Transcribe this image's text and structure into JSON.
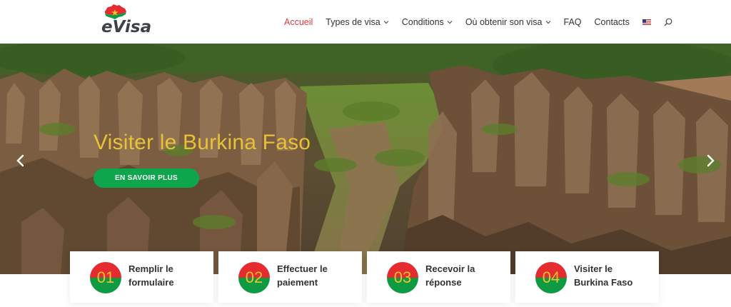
{
  "brand": {
    "logo_text": "eVisa"
  },
  "nav": {
    "items": [
      {
        "label": "Accueil",
        "active": true,
        "dropdown": false
      },
      {
        "label": "Types de visa",
        "active": false,
        "dropdown": true
      },
      {
        "label": "Conditions",
        "active": false,
        "dropdown": true
      },
      {
        "label": "Où obtenir son visa",
        "active": false,
        "dropdown": true
      },
      {
        "label": "FAQ",
        "active": false,
        "dropdown": false
      },
      {
        "label": "Contacts",
        "active": false,
        "dropdown": false
      }
    ],
    "language_icon": "us-flag-icon",
    "search_icon": "search-icon"
  },
  "hero": {
    "title": "Visiter le Burkina Faso",
    "button_label": "EN SAVOIR PLUS",
    "prev_icon": "chevron-left-icon",
    "next_icon": "chevron-right-icon"
  },
  "steps": [
    {
      "number": "01",
      "line1": "Remplir le",
      "line2": "formulaire"
    },
    {
      "number": "02",
      "line1": "Effectuer le",
      "line2": "paiement"
    },
    {
      "number": "03",
      "line1": "Recevoir la",
      "line2": "réponse"
    },
    {
      "number": "04",
      "line1": "Visiter le",
      "line2": "Burkina Faso"
    }
  ],
  "colors": {
    "accent_red": "#e03a3e",
    "button_green": "#0ea64d",
    "title_yellow": "#e8c235",
    "badge_red": "#e52b2f",
    "badge_green": "#0f9a44"
  }
}
